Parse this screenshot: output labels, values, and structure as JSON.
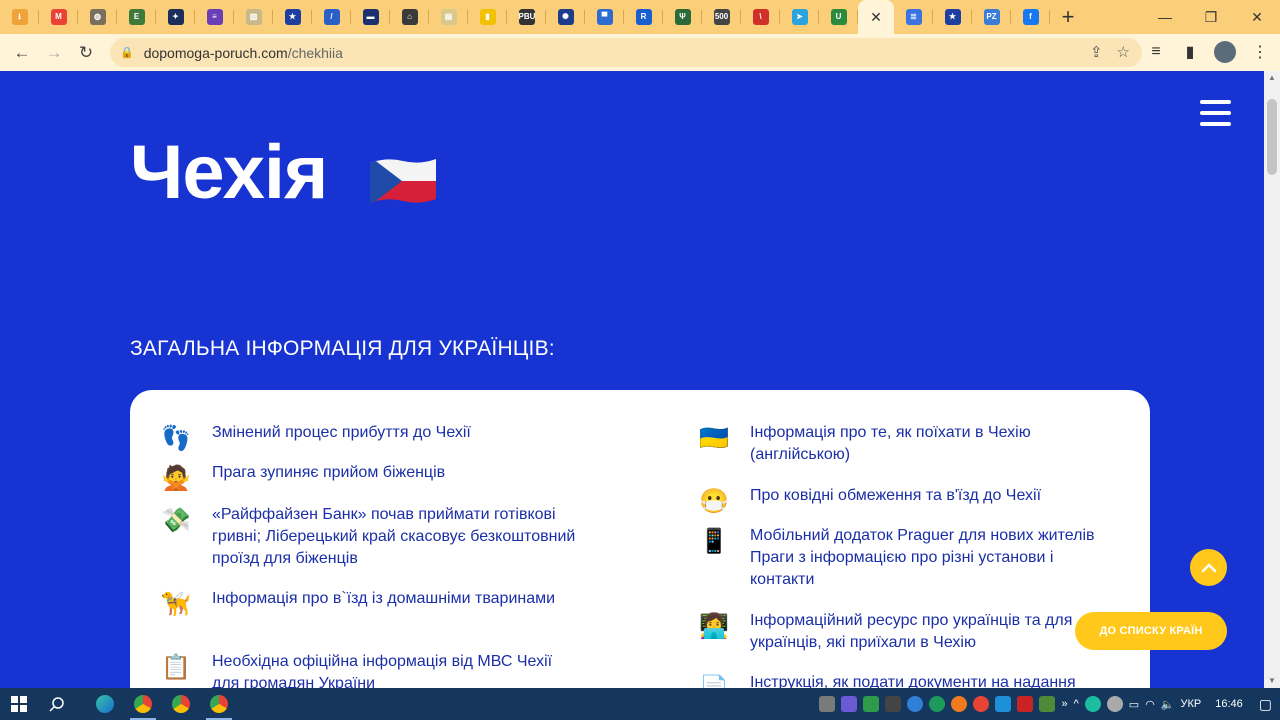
{
  "browser": {
    "url_domain": "dopomoga-poruch.com",
    "url_path": "/chekhiia",
    "tab_favicons": [
      {
        "name": "download",
        "color": "#f0a23a",
        "text": "⭳"
      },
      {
        "name": "gmail",
        "color": "#ea4335",
        "text": "M"
      },
      {
        "name": "globe",
        "color": "#7a6f5c",
        "text": "◍"
      },
      {
        "name": "e-doc",
        "color": "#3f7a3a",
        "text": "E"
      },
      {
        "name": "nato",
        "color": "#1c2f5c",
        "text": "✦"
      },
      {
        "name": "forms",
        "color": "#6a3fb5",
        "text": "≡"
      },
      {
        "name": "scroll",
        "color": "#c9b88a",
        "text": "▥"
      },
      {
        "name": "eu",
        "color": "#1f3fa0",
        "text": "★"
      },
      {
        "name": "slash",
        "color": "#2a5fc8",
        "text": "/"
      },
      {
        "name": "dark-blue",
        "color": "#1c2f6e",
        "text": "▬"
      },
      {
        "name": "museum",
        "color": "#3a3a3a",
        "text": "⌂"
      },
      {
        "name": "note",
        "color": "#d8c88a",
        "text": "▤"
      },
      {
        "name": "yellow-bars",
        "color": "#f2c200",
        "text": "▮"
      },
      {
        "name": "pbu",
        "color": "#333333",
        "text": "PBU"
      },
      {
        "name": "compass",
        "color": "#1e3c8c",
        "text": "✺"
      },
      {
        "name": "ua-stripes",
        "color": "#2f6ccf",
        "text": "▀"
      },
      {
        "name": "r-logo",
        "color": "#1a5fd0",
        "text": "R"
      },
      {
        "name": "trident",
        "color": "#2d6a3a",
        "text": "Ψ"
      },
      {
        "name": "500",
        "color": "#444444",
        "text": "500"
      },
      {
        "name": "slash-red",
        "color": "#d0302a",
        "text": "\\"
      },
      {
        "name": "telegram",
        "color": "#2aa3df",
        "text": "➤"
      },
      {
        "name": "u-green",
        "color": "#2c8a3c",
        "text": "U"
      }
    ],
    "tab_favicons_after": [
      {
        "name": "docs",
        "color": "#3b73e0",
        "text": "≣"
      },
      {
        "name": "eu2",
        "color": "#1f3fa0",
        "text": "★"
      },
      {
        "name": "pz",
        "color": "#3c7bd8",
        "text": "PZ"
      },
      {
        "name": "facebook",
        "color": "#1877f2",
        "text": "f"
      }
    ]
  },
  "page": {
    "title": "Чехія",
    "section_heading": "ЗАГАЛЬНА ІНФОРМАЦІЯ ДЛЯ УКРАЇНЦІВ:",
    "left_items": [
      {
        "icon": "footprints",
        "emoji": "👣",
        "text": "Змінений процес прибуття до Чехії"
      },
      {
        "icon": "person-gesturing-no",
        "emoji": "🙅",
        "text": "Прага зупиняє прийом біженців"
      },
      {
        "icon": "money-with-wings",
        "emoji": "💸",
        "text": "«Райффайзен Банк» почав приймати готівкові гривні; Ліберецький край скасовує безкоштовний проїзд для біженців"
      },
      {
        "icon": "guide-dog",
        "emoji": "🦮",
        "text": "Інформація про в`їзд із домашніми тваринами"
      },
      {
        "icon": "clipboard",
        "emoji": "📋",
        "text": "Необхідна офіційна інформація від МВС Чехії для громадян України"
      }
    ],
    "right_items": [
      {
        "icon": "ukraine-flag",
        "emoji": "🇺🇦",
        "text": "Інформація про те, як поїхати в Чехію (англійською)"
      },
      {
        "icon": "face-with-mask",
        "emoji": "😷",
        "text": "Про ковідні обмеження та в'їзд до Чехії"
      },
      {
        "icon": "mobile-phone-hand",
        "emoji": "📱",
        "text": "Мобільний додаток Praguer для нових жителів Праги з інформацією про різні установи і контакти"
      },
      {
        "icon": "person-laptop",
        "emoji": "👩‍💻",
        "text": "Інформаційний ресурс про українців та для українців, які приїхали в Чехію"
      },
      {
        "icon": "document",
        "emoji": "📄",
        "text": "Інструкція, як подати документи на надання"
      }
    ],
    "list_button_label": "ДО СПИСКУ КРАЇН"
  },
  "taskbar": {
    "language": "УКР",
    "time": "16:46"
  }
}
